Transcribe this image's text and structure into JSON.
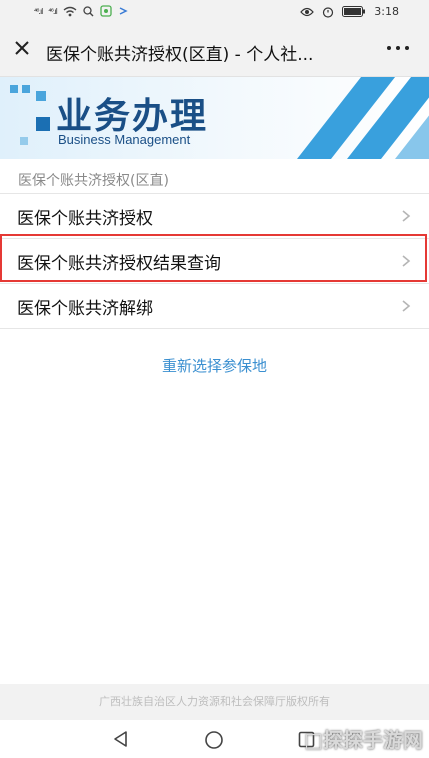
{
  "statusbar": {
    "signal1": "⁴⁶.ıl",
    "signal2": "⁴⁶.ıl",
    "time": "3:18"
  },
  "header": {
    "title": "医保个账共济授权(区直) - 个人社..."
  },
  "banner": {
    "title": "业务办理",
    "subtitle": "Business Management"
  },
  "section": {
    "label": "医保个账共济授权(区直)"
  },
  "menu": {
    "items": [
      {
        "label": "医保个账共济授权"
      },
      {
        "label": "医保个账共济授权结果查询"
      },
      {
        "label": "医保个账共济解绑"
      }
    ]
  },
  "reselect_label": "重新选择参保地",
  "footer": {
    "copyright": "广西壮族自治区人力资源和社会保障厅版权所有"
  },
  "watermark": "□探探手游网",
  "colors": {
    "accent": "#3a8fd0",
    "highlight": "#e53935",
    "banner_text": "#1a4f86"
  }
}
